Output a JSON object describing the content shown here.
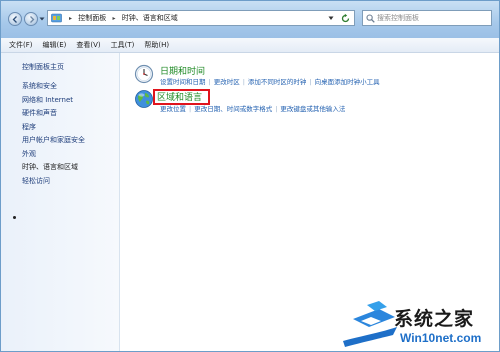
{
  "address": {
    "crumbs": [
      "控制面板",
      "时钟、语言和区域"
    ]
  },
  "search": {
    "placeholder": "搜索控制面板"
  },
  "menu": [
    "文件(F)",
    "编辑(E)",
    "查看(V)",
    "工具(T)",
    "帮助(H)"
  ],
  "sidebar": {
    "home": "控制面板主页",
    "items": [
      "系统和安全",
      "网络和 Internet",
      "硬件和声音",
      "程序",
      "用户帐户和家庭安全",
      "外观",
      "时钟、语言和区域",
      "轻松访问"
    ],
    "current_index": 6
  },
  "categories": [
    {
      "title": "日期和时间",
      "icon": "clock-icon",
      "tasks": [
        "设置时间和日期",
        "更改时区",
        "添加不同时区的时钟",
        "向桌面添加时钟小工具"
      ]
    },
    {
      "title": "区域和语言",
      "icon": "globe-icon",
      "tasks": [
        "更改位置",
        "更改日期、时间或数字格式",
        "更改键盘或其他输入法"
      ],
      "highlighted": true
    }
  ],
  "watermark": {
    "line1": "系统之家",
    "line2": "Win10net.com"
  },
  "colors": {
    "highlight": "#e0141c",
    "category_title": "#1f8a25",
    "link": "#2462b1"
  }
}
